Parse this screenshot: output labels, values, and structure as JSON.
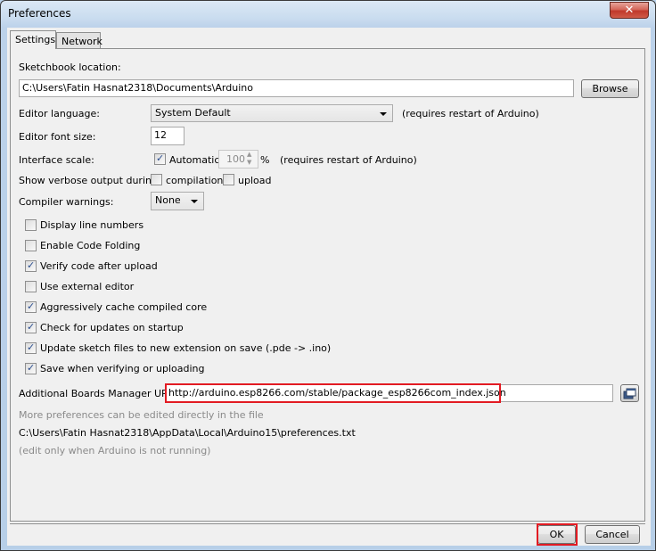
{
  "window": {
    "title": "Preferences",
    "close_label": "x"
  },
  "tabs": [
    {
      "label": "Settings",
      "active": true
    },
    {
      "label": "Network",
      "active": false
    }
  ],
  "settings": {
    "sketchbook_label": "Sketchbook location:",
    "sketchbook_value": "C:\\Users\\Fatin Hasnat2318\\Documents\\Arduino",
    "browse_label": "Browse",
    "editor_language_label": "Editor language:",
    "editor_language_value": "System Default",
    "editor_language_note": "(requires restart of Arduino)",
    "editor_font_size_label": "Editor font size:",
    "editor_font_size_value": "12",
    "interface_scale_label": "Interface scale:",
    "interface_scale_auto_label": "Automatic",
    "interface_scale_auto_checked": true,
    "interface_scale_value": "100",
    "interface_scale_unit": "%",
    "interface_scale_note": "(requires restart of Arduino)",
    "verbose_label": "Show verbose output during:",
    "verbose_compilation_label": "compilation",
    "verbose_compilation_checked": false,
    "verbose_upload_label": "upload",
    "verbose_upload_checked": false,
    "compiler_warnings_label": "Compiler warnings:",
    "compiler_warnings_value": "None",
    "checkboxes": [
      {
        "label": "Display line numbers",
        "checked": false
      },
      {
        "label": "Enable Code Folding",
        "checked": false
      },
      {
        "label": "Verify code after upload",
        "checked": true
      },
      {
        "label": "Use external editor",
        "checked": false
      },
      {
        "label": "Aggressively cache compiled core",
        "checked": true
      },
      {
        "label": "Check for updates on startup",
        "checked": true
      },
      {
        "label": "Update sketch files to new extension on save (.pde -> .ino)",
        "checked": true
      },
      {
        "label": "Save when verifying or uploading",
        "checked": true
      }
    ],
    "boards_urls_label": "Additional Boards Manager URLs:",
    "boards_urls_value": "http://arduino.esp8266.com/stable/package_esp8266com_index.json",
    "more_prefs_note": "More preferences can be edited directly in the file",
    "prefs_path": "C:\\Users\\Fatin Hasnat2318\\AppData\\Local\\Arduino15\\preferences.txt",
    "edit_note": "(edit only when Arduino is not running)"
  },
  "footer": {
    "ok_label": "OK",
    "cancel_label": "Cancel"
  },
  "colors": {
    "highlight": "#e21b23",
    "check": "#2a4d8f"
  }
}
